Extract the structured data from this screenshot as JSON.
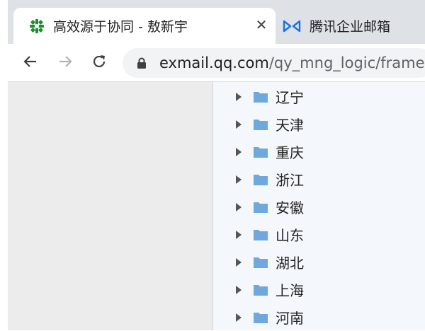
{
  "browser": {
    "tabs": [
      {
        "title": "高效源于协同 - 敖新宇",
        "active": true,
        "icon": "green-pinwheel-icon"
      },
      {
        "title": "腾讯企业邮箱",
        "active": false,
        "icon": "tencent-exmail-icon"
      }
    ],
    "close_glyph": "✕",
    "url_host": "exmail.qq.com",
    "url_path": "/qy_mng_logic/frame?s"
  },
  "tree": {
    "items": [
      {
        "label": "辽宁"
      },
      {
        "label": "天津"
      },
      {
        "label": "重庆"
      },
      {
        "label": "浙江"
      },
      {
        "label": "安徽"
      },
      {
        "label": "山东"
      },
      {
        "label": "湖北"
      },
      {
        "label": "上海"
      },
      {
        "label": "河南"
      }
    ]
  },
  "colors": {
    "folder": "#6fa8dc",
    "tabbar": "#dee1e6",
    "tencent_icon": "#1a6fe8",
    "favicon_green": "#1e8f2f"
  }
}
